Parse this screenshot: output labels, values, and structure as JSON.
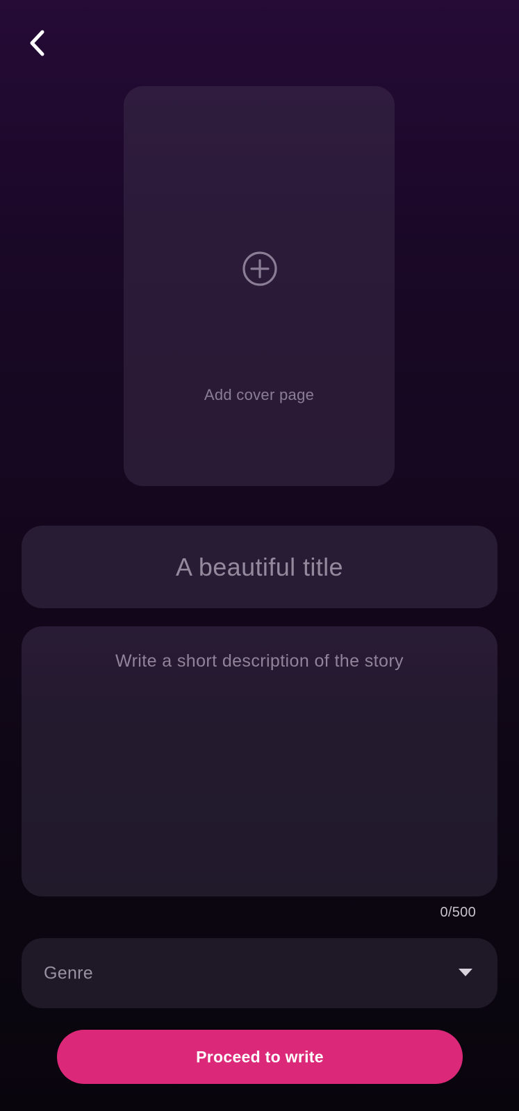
{
  "header": {
    "back_icon": "chevron-left-icon"
  },
  "cover": {
    "icon": "plus-circle-icon",
    "label": "Add cover page"
  },
  "title_field": {
    "placeholder": "A beautiful title",
    "value": ""
  },
  "description_field": {
    "placeholder": "Write a short description of the story",
    "value": "",
    "char_count": "0/500"
  },
  "genre_select": {
    "label": "Genre",
    "icon": "caret-down-icon"
  },
  "proceed_button": {
    "label": "Proceed to write",
    "color": "#dc2878"
  },
  "colors": {
    "background_top": "#250b36",
    "background_bottom": "#09050d",
    "card": "#2b1a38",
    "field": "#281c34"
  }
}
